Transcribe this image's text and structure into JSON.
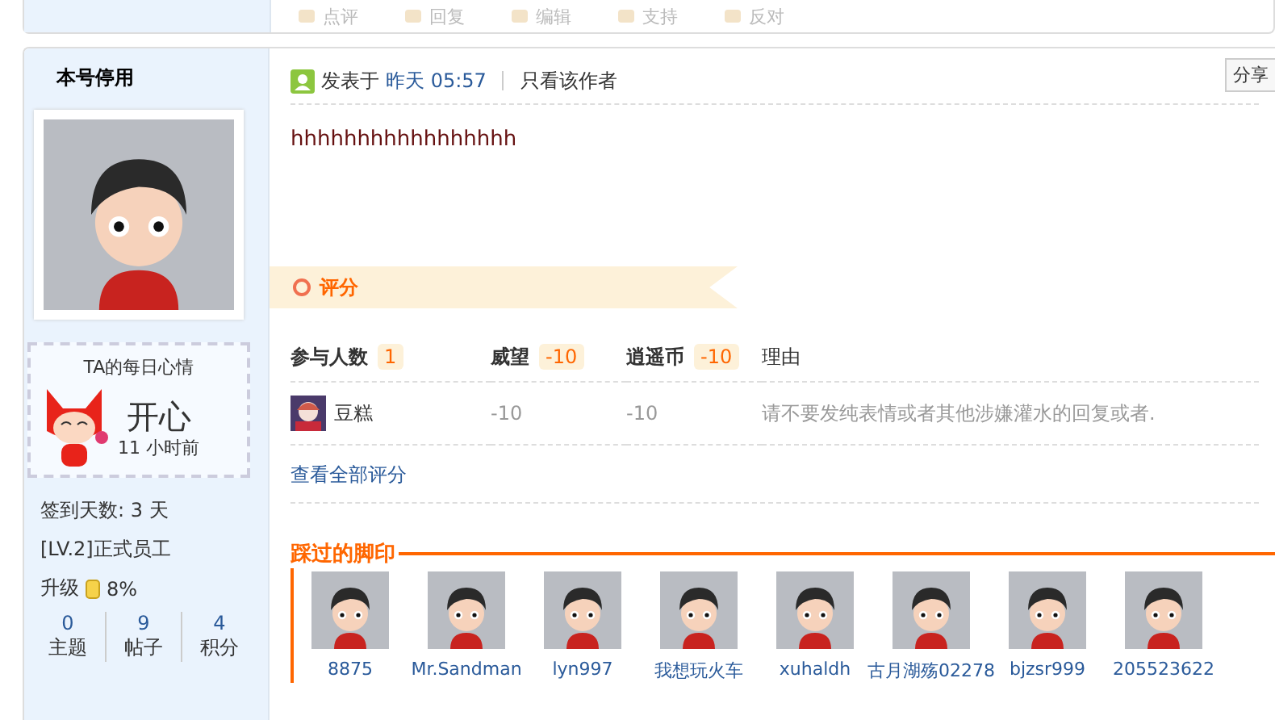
{
  "action_bar": [
    {
      "label": "点评"
    },
    {
      "label": "回复"
    },
    {
      "label": "编辑"
    },
    {
      "label": "支持"
    },
    {
      "label": "反对"
    }
  ],
  "author": {
    "name": "本号停用"
  },
  "mood": {
    "title": "TA的每日心情",
    "mood": "开心",
    "time": "11 小时前"
  },
  "user_info": [
    "签到天数: 3 天",
    "[LV.2]正式员工"
  ],
  "upgrade": {
    "label": "升级",
    "percent": "8%"
  },
  "stats": [
    {
      "value": "0",
      "label": "主题"
    },
    {
      "value": "9",
      "label": "帖子"
    },
    {
      "value": "4",
      "label": "积分"
    }
  ],
  "post": {
    "meta_prefix": "发表于",
    "date": "昨天 05:57",
    "author_only": "只看该作者",
    "share": "分享",
    "body": "hhhhhhhhhhhhhhhhh"
  },
  "rating": {
    "title": "评分",
    "columns": [
      {
        "label": "参与人数",
        "badge": "1"
      },
      {
        "label": "威望",
        "badge": "-10"
      },
      {
        "label": "逍遥币",
        "badge": "-10"
      },
      {
        "label": "理由"
      }
    ],
    "rows": [
      {
        "user": "豆糕",
        "values": [
          "-10",
          "-10"
        ],
        "reason": "请不要发纯表情或者其他涉嫌灌水的回复或者."
      }
    ],
    "view_all": "查看全部评分"
  },
  "footprints": {
    "title": "踩过的脚印",
    "users": [
      "8875",
      "Mr.Sandman",
      "lyn997",
      "我想玩火车",
      "xuhaldh",
      "古月湖殇02278",
      "bjzsr999",
      "205523622"
    ]
  }
}
